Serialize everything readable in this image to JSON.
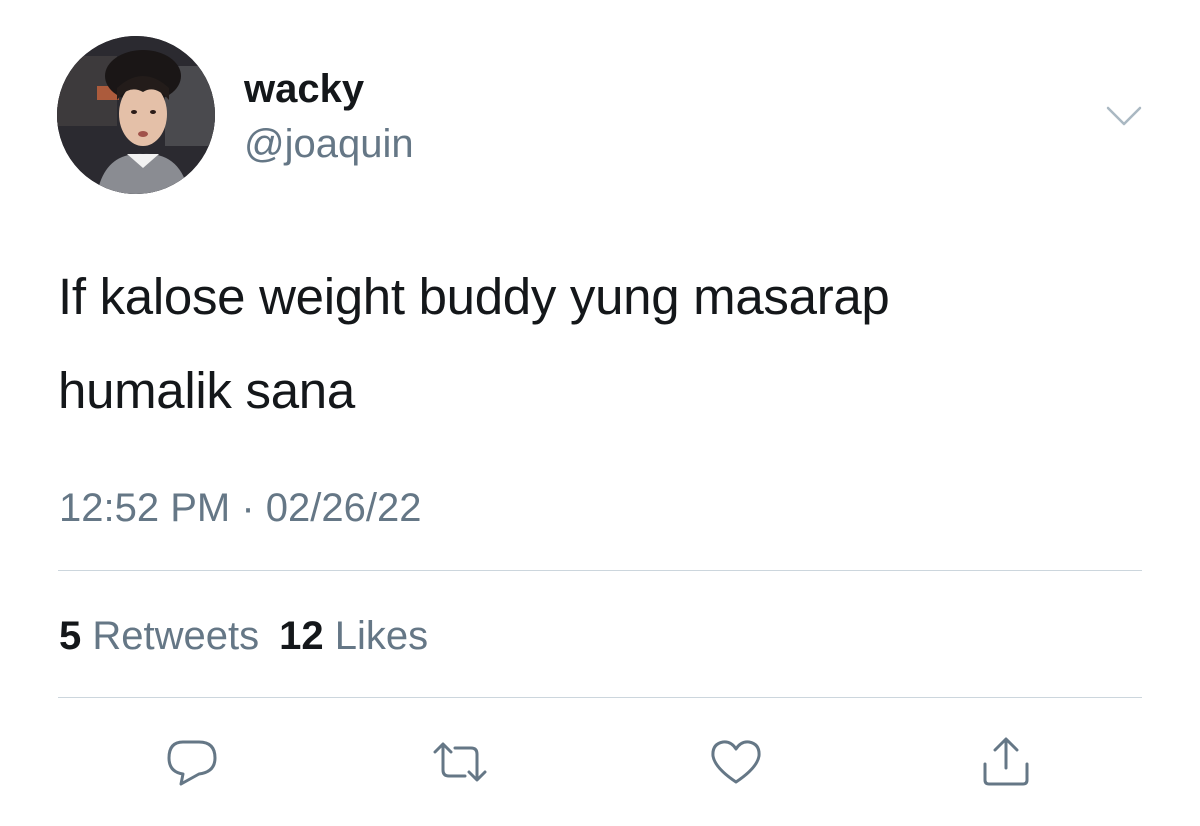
{
  "author": {
    "display_name": "wacky",
    "handle": "@joaquin",
    "avatar_icon": "profile-photo"
  },
  "tweet": {
    "text_lines": [
      "If kalose weight buddy yung masarap",
      "humalik sana"
    ],
    "timestamp": "12:52 PM · 02/26/22"
  },
  "stats": {
    "retweets_count": "5",
    "retweets_label": "Retweets",
    "likes_count": "12",
    "likes_label": "Likes"
  },
  "actions": {
    "reply_icon": "reply-icon",
    "retweet_icon": "retweet-icon",
    "like_icon": "heart-icon",
    "share_icon": "share-icon"
  },
  "colors": {
    "text_primary": "#14171a",
    "text_secondary": "#657786",
    "divider": "#ccd6dd",
    "background": "#ffffff"
  }
}
